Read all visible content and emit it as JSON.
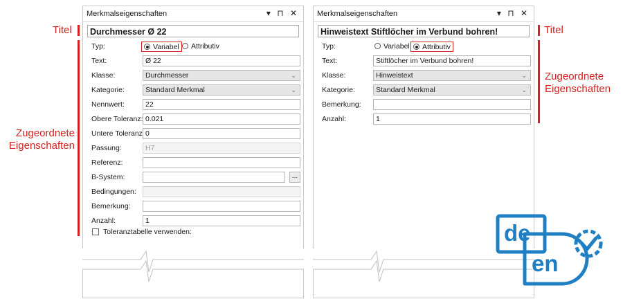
{
  "annotations": {
    "left_title": "Titel",
    "left_assigned": [
      "Zugeordnete",
      "Eigenschaften"
    ],
    "right_title": "Titel",
    "right_assigned": [
      "Zugeordnete",
      "Eigenschaften"
    ],
    "color": "#d42020"
  },
  "left_panel": {
    "header": "Merkmalseigenschaften",
    "title": "Durchmesser Ø 22",
    "typ_label": "Typ:",
    "radio_variabel": "Variabel",
    "radio_attributiv": "Attributiv",
    "selected": "Variabel",
    "fields": {
      "text": {
        "label": "Text:",
        "value": "Ø 22"
      },
      "klasse": {
        "label": "Klasse:",
        "value": "Durchmesser"
      },
      "kategorie": {
        "label": "Kategorie:",
        "value": "Standard Merkmal"
      },
      "nennwert": {
        "label": "Nennwert:",
        "value": "22"
      },
      "obere": {
        "label": "Obere Toleranz:",
        "value": "0.021"
      },
      "untere": {
        "label": "Untere Toleranz:",
        "value": "0"
      },
      "passung": {
        "label": "Passung:",
        "value": "H7"
      },
      "referenz": {
        "label": "Referenz:",
        "value": ""
      },
      "bsystem": {
        "label": "B-System:",
        "value": "",
        "button": "..."
      },
      "bedingungen": {
        "label": "Bedingungen:",
        "value": ""
      },
      "bemerkung": {
        "label": "Bemerkung:",
        "value": ""
      },
      "anzahl": {
        "label": "Anzahl:",
        "value": "1"
      }
    },
    "checkbox_label": "Toleranztabelle verwenden:"
  },
  "right_panel": {
    "header": "Merkmalseigenschaften",
    "title": "Hinweistext Stiftlöcher im Verbund bohren!",
    "typ_label": "Typ:",
    "radio_variabel": "Variabel",
    "radio_attributiv": "Attributiv",
    "selected": "Attributiv",
    "fields": {
      "text": {
        "label": "Text:",
        "value": "Stiftlöcher im Verbund bohren!"
      },
      "klasse": {
        "label": "Klasse:",
        "value": "Hinweistext"
      },
      "kategorie": {
        "label": "Kategorie:",
        "value": "Standard Merkmal"
      },
      "bemerkung": {
        "label": "Bemerkung:",
        "value": ""
      },
      "anzahl": {
        "label": "Anzahl:",
        "value": "1"
      }
    }
  },
  "panel_icons": {
    "dropdown": "▾",
    "pin": "⊓",
    "close": "✕"
  },
  "logo": {
    "line1": "de",
    "line2": "en",
    "color": "#1f7fc2"
  }
}
